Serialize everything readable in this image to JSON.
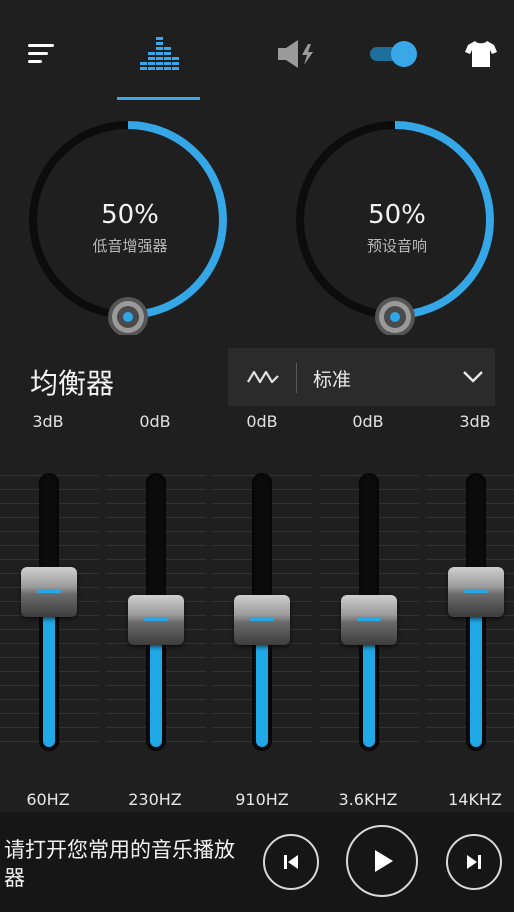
{
  "topbar": {
    "icons": [
      "menu-icon",
      "equalizer-icon",
      "speaker-boost-icon",
      "toggle-switch",
      "tshirt-icon"
    ],
    "accent": "#3aa8e8"
  },
  "knobs": [
    {
      "value": "50%",
      "label": "低音增强器",
      "fraction": 0.5
    },
    {
      "value": "50%",
      "label": "预设音响",
      "fraction": 0.5
    }
  ],
  "equalizer": {
    "title": "均衡器",
    "preset": "标准",
    "bands": [
      {
        "db": "3dB",
        "freq": "60HZ",
        "level": 0.6
      },
      {
        "db": "0dB",
        "freq": "230HZ",
        "level": 0.5
      },
      {
        "db": "0dB",
        "freq": "910HZ",
        "level": 0.5
      },
      {
        "db": "0dB",
        "freq": "3.6KHZ",
        "level": 0.5
      },
      {
        "db": "3dB",
        "freq": "14KHZ",
        "level": 0.6
      }
    ]
  },
  "player": {
    "hint": "请打开您常用的音乐播放器"
  }
}
